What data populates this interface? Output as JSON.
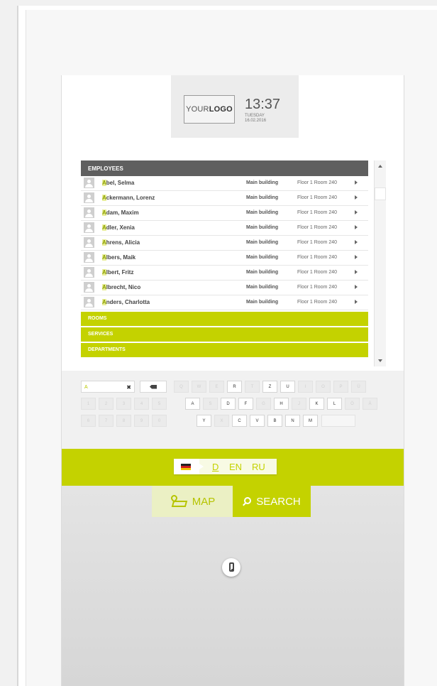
{
  "branding": {
    "logo_text_light": "YOUR",
    "logo_text_bold": "LOGO",
    "time": "13:37",
    "weekday": "TUESDAY",
    "date": "16.02.2016"
  },
  "directory": {
    "header": "EMPLOYEES",
    "employees": [
      {
        "initial": "A",
        "rest": "bel, Selma",
        "building": "Main building",
        "room": "Floor 1 Room 240"
      },
      {
        "initial": "A",
        "rest": "ckermann, Lorenz",
        "building": "Main building",
        "room": "Floor 1 Room 240"
      },
      {
        "initial": "A",
        "rest": "dam, Maxim",
        "building": "Main building",
        "room": "Floor 1 Room 240"
      },
      {
        "initial": "A",
        "rest": "dler, Xenia",
        "building": "Main building",
        "room": "Floor 1 Room 240"
      },
      {
        "initial": "A",
        "rest": "hrens, Alicia",
        "building": "Main building",
        "room": "Floor 1 Room 240"
      },
      {
        "initial": "A",
        "rest": "lbers, Maik",
        "building": "Main building",
        "room": "Floor 1 Room 240"
      },
      {
        "initial": "A",
        "rest": "lbert, Fritz",
        "building": "Main building",
        "room": "Floor 1 Room 240"
      },
      {
        "initial": "A",
        "rest": "lbrecht, Nico",
        "building": "Main building",
        "room": "Floor 1 Room 240"
      },
      {
        "initial": "A",
        "rest": "nders, Charlotta",
        "building": "Main building",
        "room": "Floor 1 Room 240"
      }
    ],
    "categories": [
      "ROOMS",
      "SERVICES",
      "DEPARTMENTS"
    ]
  },
  "search": {
    "value": "A",
    "clear_icon": "✖"
  },
  "keyboard": {
    "row1": [
      "Q",
      "W",
      "E",
      "R",
      "T",
      "Z",
      "U",
      "I",
      "O",
      "P",
      "Ü"
    ],
    "row1_active": [
      false,
      false,
      false,
      true,
      false,
      true,
      true,
      false,
      false,
      false,
      false
    ],
    "row2": [
      "1",
      "2",
      "3",
      "4",
      "5",
      "A",
      "S",
      "D",
      "F",
      "G",
      "H",
      "J",
      "K",
      "L",
      "Ö",
      "Ä"
    ],
    "row2_active": [
      false,
      false,
      false,
      false,
      false,
      true,
      false,
      true,
      true,
      false,
      true,
      false,
      true,
      true,
      false,
      false
    ],
    "row3": [
      "6",
      "7",
      "8",
      "9",
      "0",
      "Y",
      "X",
      "C",
      "V",
      "B",
      "N",
      "M"
    ],
    "row3_active": [
      false,
      false,
      false,
      false,
      false,
      true,
      false,
      true,
      true,
      true,
      true,
      true
    ]
  },
  "languages": {
    "options": [
      "D",
      "EN",
      "RU"
    ],
    "selected": "D"
  },
  "nav": {
    "map_label": "MAP",
    "search_label": "SEARCH"
  },
  "colors": {
    "accent": "#c4d200",
    "header_bar": "#5f5f5f",
    "highlight": "#e8ee9a"
  }
}
